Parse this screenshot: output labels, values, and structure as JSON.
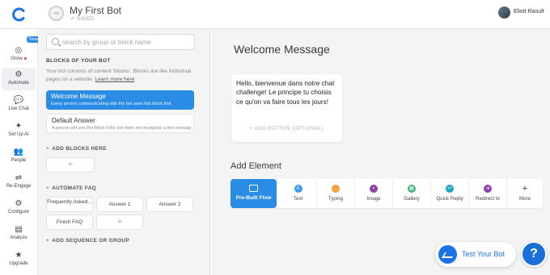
{
  "topbar": {
    "bot_name": "My First Bot",
    "saved_label": "SAVED",
    "user_name": "Eliott Raoult"
  },
  "nav": {
    "grow": "Grow",
    "new_badge": "New",
    "automate": "Automate",
    "live_chat": "Live Chat",
    "set_up_ai": "Set Up AI",
    "people": "People",
    "re_engage": "Re-Engage",
    "configure": "Configure",
    "analyze": "Analyze",
    "upgrade": "Upgrade"
  },
  "blocks": {
    "search_placeholder": "search by group or block name",
    "section_title": "BLOCKS OF YOUR BOT",
    "description": "Your bot consists of content 'blocks'. Blocks are like individual pages on a website.",
    "learn_more": "Learn more here",
    "welcome_title": "Welcome Message",
    "welcome_sub": "Every person communicating with the bot sees this block first",
    "default_title": "Default Answer",
    "default_sub": "A person will see this block if the bot does not recognize a text message",
    "add_blocks": "ADD BLOCKS HERE",
    "automate_faq": "AUTOMATE FAQ",
    "faq_items": [
      "Frequently Asked...",
      "Answer 1",
      "Answer 2",
      "Finish FAQ"
    ],
    "add_sequence": "ADD SEQUENCE OR GROUP"
  },
  "main": {
    "title": "Welcome Message",
    "message": "Hello, bienvenue dans notre chat challenge! Le principe tu choisis ce qu'on va faire tous les jours!",
    "add_button": "ADD BUTTON (OPTIONAL)",
    "add_element": "Add Element",
    "elements": [
      {
        "label": "Pre-Built Flow",
        "icon": "flow-icon"
      },
      {
        "label": "Text",
        "icon": "text-icon",
        "color": "#3d9be9"
      },
      {
        "label": "Typing",
        "icon": "typing-icon",
        "color": "#f0a23a"
      },
      {
        "label": "Image",
        "icon": "image-icon",
        "color": "#8e44ad"
      },
      {
        "label": "Gallery",
        "icon": "gallery-icon",
        "color": "#3fb37f"
      },
      {
        "label": "Quick Reply",
        "icon": "quick-reply-icon",
        "color": "#1fa7c4"
      },
      {
        "label": "Redirect to",
        "icon": "redirect-icon",
        "color": "#8e44ad"
      },
      {
        "label": "More",
        "icon": "plus-icon"
      }
    ],
    "test_bot": "Test Your Bot",
    "help": "?"
  },
  "colors": {
    "accent": "#2b8ce6",
    "messenger": "#1a73e8"
  }
}
